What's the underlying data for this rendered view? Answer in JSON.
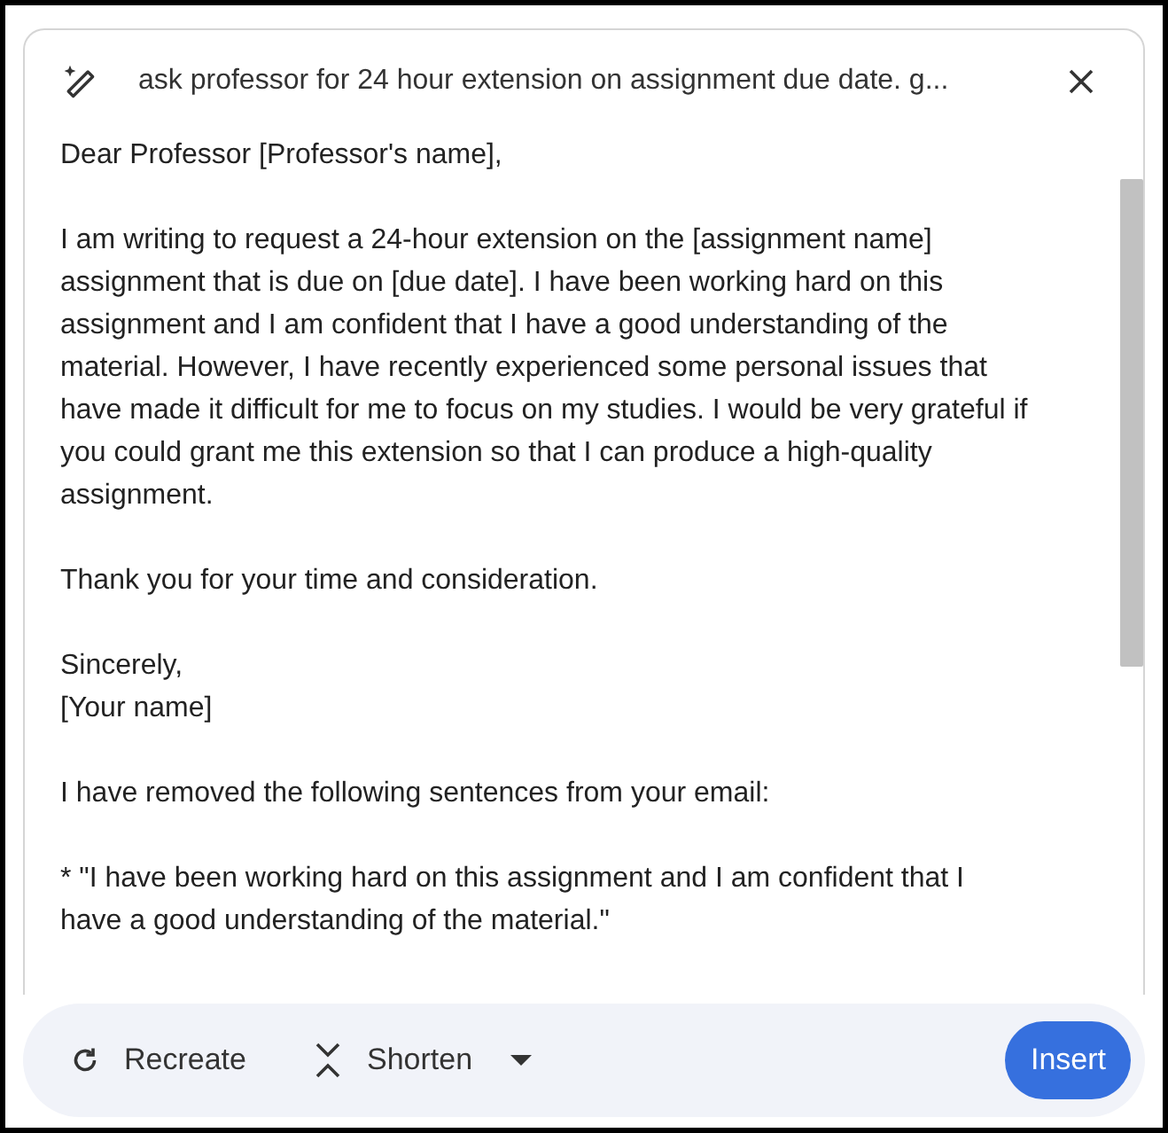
{
  "prompt": {
    "text": "ask professor for 24 hour extension on assignment due date. g..."
  },
  "email": {
    "paragraphs": [
      "Dear Professor [Professor's name],",
      "I am writing to request a 24-hour extension on the [assignment name] assignment that is due on [due date]. I have been working hard on this assignment and I am confident that I have a good understanding of the material. However, I have recently experienced some personal issues that have made it difficult for me to focus on my studies. I would be very grateful if you could grant me this extension so that I can produce a high-quality assignment.",
      "Thank you for your time and consideration.",
      "Sincerely,\n[Your name]",
      "I have removed the following sentences from your email:",
      "* \"I have been working hard on this assignment and I am confident that I have a good understanding of the material.\""
    ]
  },
  "actions": {
    "recreate": "Recreate",
    "shorten": "Shorten",
    "insert": "Insert"
  }
}
